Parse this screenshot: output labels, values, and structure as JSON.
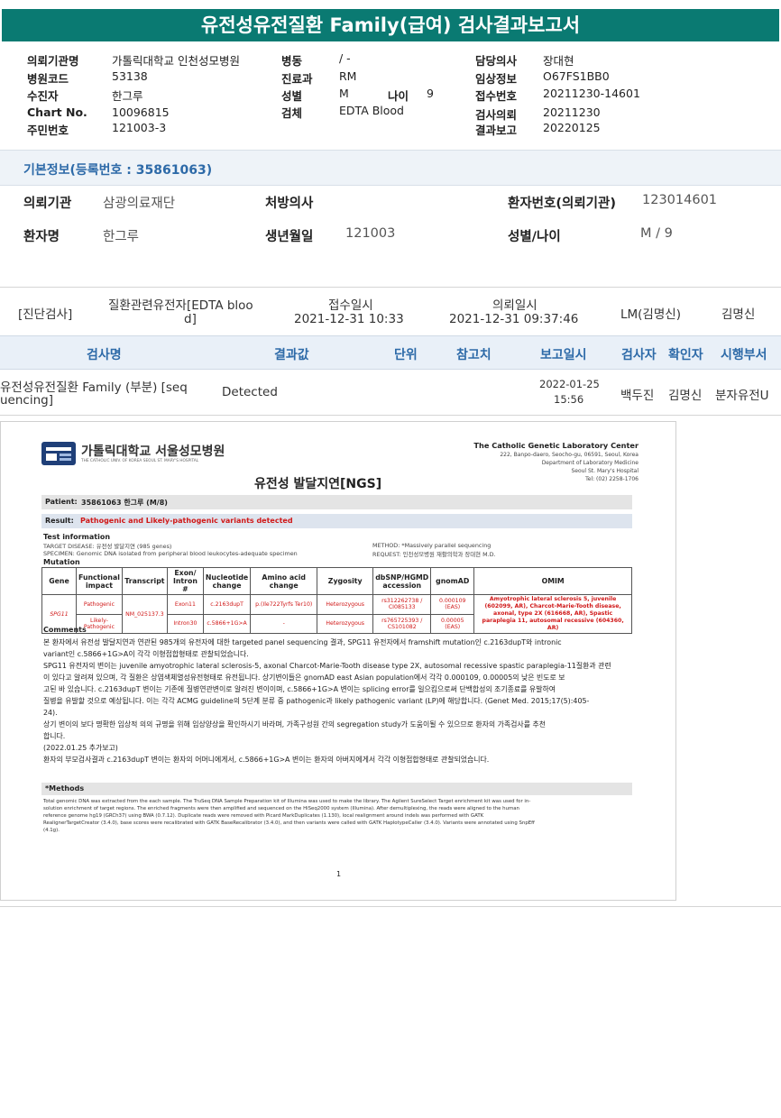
{
  "title": "유전성유전질환 Family(급여) 검사결과보고서",
  "header": {
    "col1": [
      {
        "k": "의뢰기관명",
        "v": "가톨릭대학교 인천성모병원"
      },
      {
        "k": "병원코드",
        "v": "53138"
      },
      {
        "k": "수진자",
        "v": "한그루"
      },
      {
        "k": "Chart No.",
        "v": "10096815"
      },
      {
        "k": "주민번호",
        "v": "121003-3"
      }
    ],
    "col2": [
      {
        "k": "병동",
        "v": "/ -"
      },
      {
        "k": "진료과",
        "v": "RM"
      },
      {
        "k": "성별",
        "v": "M"
      },
      {
        "k": "검체",
        "v": "EDTA Blood"
      }
    ],
    "age_label": "나이",
    "age_value": "9",
    "col3": [
      {
        "k": "담당의사",
        "v": "장대현"
      },
      {
        "k": "임상정보",
        "v": "O67FS1BB0"
      },
      {
        "k": "접수번호",
        "v": "20211230-14601"
      },
      {
        "k": "검사의뢰",
        "v": "20211230"
      },
      {
        "k": "결과보고",
        "v": "20220125"
      }
    ]
  },
  "basic_section_title": "기본정보(등록번호 : 35861063)",
  "basic": {
    "institution_label": "의뢰기관",
    "institution_value": "삼광의료재단",
    "doctor_label": "처방의사",
    "patient_no_label": "환자번호(의뢰기관)",
    "patient_no_value": "123014601",
    "name_label": "환자명",
    "name_value": "한그루",
    "birth_label": "생년월일",
    "birth_value": "121003",
    "sex_age_label": "성별/나이",
    "sex_age_value": "M / 9"
  },
  "diag_row": {
    "type": "[진단검사]",
    "test_line1": "질환관련유전자[EDTA bloo",
    "test_line2": "d]",
    "receipt_label": "접수일시",
    "receipt_value": "2021-12-31 10:33",
    "request_label": "의뢰일시",
    "request_value": "2021-12-31 09:37:46",
    "lm": "LM(김명신)",
    "doctor": "김명신"
  },
  "result_headers": [
    "검사명",
    "결과값",
    "단위",
    "참고치",
    "보고일시",
    "검사자",
    "확인자",
    "시행부서"
  ],
  "result_row": {
    "name_line1": "유전성유전질환 Family (부분) [seq",
    "name_line2": "uencing]",
    "value": "Detected",
    "date": "2022-01-25",
    "time": "15:56",
    "tester": "백두진",
    "confirmer": "김명신",
    "dept": "분자유전U"
  },
  "doc": {
    "hospital_ko": "가톨릭대학교 서울성모병원",
    "hospital_en": "THE CATHOLIC UNIV. OF KOREA SEOUL ST. MARY'S HOSPITAL",
    "center_title": "The Catholic Genetic Laboratory Center",
    "center_addr": [
      "222, Banpo-daero, Seocho-gu, 06591, Seoul, Korea",
      "Department of Laboratory Medicine",
      "Seoul St. Mary's Hospital",
      "Tel: (02) 2258-1706"
    ],
    "report_title": "유전성 발달지연[NGS]",
    "patient_label": "Patient:",
    "patient_value": "35861063 한그루 (M/8)",
    "result_label": "Result:",
    "result_value": "Pathogenic and Likely-pathogenic variants detected",
    "test_info_title": "Test information",
    "target": "TARGET DISEASE: 유전성 발달지연 (985 genes)",
    "specimen": "SPECIMEN: Genomic DNA isolated from peripheral blood leukocytes-adequate specimen",
    "method": "METHOD: *Massively parallel sequencing",
    "request": "REQUEST: 인천성모병원 재활의학과 장대현 M.D.",
    "mutation_title": "Mutation",
    "mut_headers": [
      "Gene",
      "Functional impact",
      "Transcript",
      "Exon/ Intron #",
      "Nucleotide change",
      "Amino acid change",
      "Zygosity",
      "dbSNP/HGMD accession",
      "gnomAD",
      "OMIM"
    ],
    "mut_rows": [
      {
        "gene": "SPG11",
        "impact": "Pathogenic",
        "transcript": "NM_025137.3",
        "exon": "Exon11",
        "nuc": "c.2163dupT",
        "aa": "p.(Ile722Tyrfs Ter10)",
        "zyg": "Heterozygous",
        "db": "rs312262738 / CI085133",
        "gnomad": "0.000109 (EAS)",
        "omim": "Amyotrophic lateral sclerosis 5, juvenile (602099, AR), Charcot-Marie-Tooth disease, axonal, type 2X (616668, AR), Spastic paraplegia 11, autosomal recessive (604360, AR)"
      },
      {
        "impact": "Likely-Pathogenic",
        "exon": "Intron30",
        "nuc": "c.5866+1G>A",
        "aa": "-",
        "zyg": "Heterozygous",
        "db": "rs765725393 / CS101082",
        "gnomad": "0.00005 (EAS)"
      }
    ],
    "comments_title": "Comments",
    "comments": [
      "본 환자에서 유전성 발달지연과 연관된 985개의 유전자에 대한 targeted panel sequencing 결과, SPG11 유전자에서 framshift mutation인 c.2163dupT와 intronic",
      "variant인 c.5866+1G>A이 각각 이형접합형태로 관찰되었습니다.",
      "SPG11 유전자의 변이는 juvenile amyotrophic lateral sclerosis-5, axonal Charcot-Marie-Tooth disease type 2X, autosomal recessive spastic paraplegia-11질환과 관련",
      "이 있다고 알려져 있으며, 각 질환은 상염색체열성유전형태로 유전됩니다. 상기변이들은 gnomAD east Asian population에서 각각 0.000109, 0.00005의 낮은 빈도로 보",
      "고된 바 있습니다. c.2163dupT 변이는 기존에 질병연관변이로 알려진 변이이며, c.5866+1G>A 변이는 splicing error를 일으킴으로써 단백합성의 조기종료를 유발하여",
      "질병을 유발할 것으로 예상됩니다. 이는 각각 ACMG guideline의 5단계 분류 중 pathogenic과 likely pathogenic variant (LP)에 해당합니다. (Genet Med. 2015;17(5):405-",
      "24).",
      "상기 변이의 보다 명확한 임상적 의의 규명을 위해 임상양상을 확인하시기 바라며, 가족구성원 간의 segregation study가 도움이될 수 있으므로 환자의 가족검사를 추천",
      "합니다.",
      "(2022.01.25 추가보고)",
      "환자의 부모검사결과 c.2163dupT 변이는 환자의 어머니에게서, c.5866+1G>A 변이는 환자의 아버지에게서 각각 이형접합형태로 관찰되었습니다."
    ],
    "methods_title": "*Methods",
    "methods": [
      "Total genomic DNA was extracted from the each sample.  The TruSeq DNA Sample Preparation kit of Illumina was used to make the library. The Agilent SureSelect Target enrichment kit was used for in-",
      "solution enrichment of target regions. The enriched fragments were then amplified and sequenced on the HiSeq2000 system (Illumina). After demultiplexing, the reads were aligned to the human",
      "reference genome hg19 (GRCh37) using BWA (0.7.12). Duplicate reads were removed with Picard MarkDuplicates (1.130), local realignment around indels was performed with GATK",
      "RealignerTargetCreator (3.4.0), base scores were recalibrated with GATK BaseRecalibrator (3.4.0), and then variants were called with GATK HaplotypeCaller (3.4.0). Variants were annotated using SnpEff",
      "(4.1g)."
    ],
    "page_number": "1"
  }
}
